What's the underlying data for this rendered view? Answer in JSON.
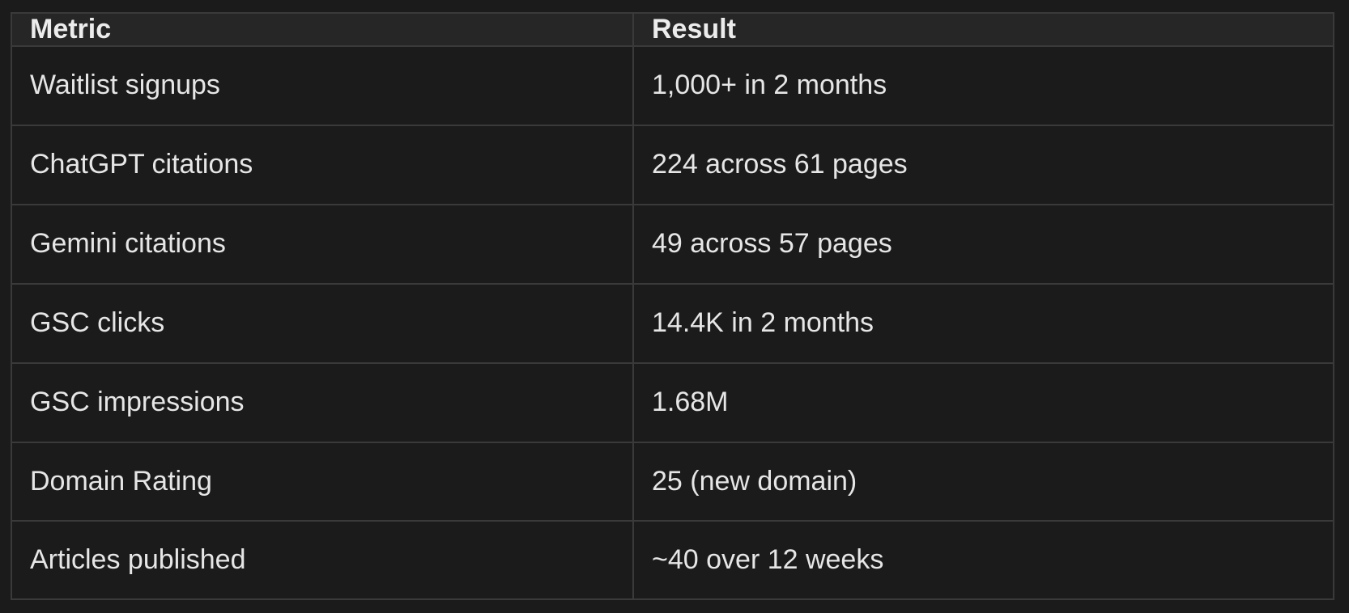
{
  "table": {
    "headers": [
      "Metric",
      "Result"
    ],
    "rows": [
      [
        "Waitlist signups",
        "1,000+ in 2 months"
      ],
      [
        "ChatGPT citations",
        "224 across 61 pages"
      ],
      [
        "Gemini citations",
        "49 across 57 pages"
      ],
      [
        "GSC clicks",
        "14.4K in 2 months"
      ],
      [
        "GSC impressions",
        "1.68M"
      ],
      [
        "Domain Rating",
        "25 (new domain)"
      ],
      [
        "Articles published",
        "~40 over 12 weeks"
      ]
    ]
  },
  "colors": {
    "background": "#1b1b1b",
    "header_background": "#262626",
    "border": "#3a3a3a",
    "text": "#e6e6e6"
  }
}
